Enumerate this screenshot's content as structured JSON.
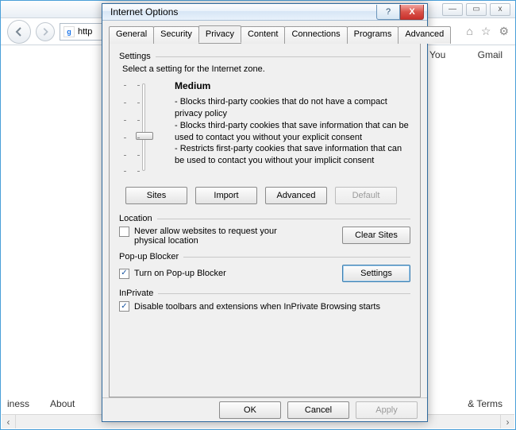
{
  "browser": {
    "addr_scheme": "http",
    "top_links": [
      "You",
      "Gmail"
    ],
    "bottom_links_left": [
      "iness",
      "About"
    ],
    "bottom_links_right": "& Terms",
    "titlebar_icons": {
      "min": "—",
      "max": "▭",
      "close": "x"
    },
    "toolbar_icons": {
      "home": "⌂",
      "star": "☆",
      "gear": "⚙"
    }
  },
  "dialog": {
    "title": "Internet Options",
    "help_icon": "?",
    "close_icon": "X",
    "tabs": [
      "General",
      "Security",
      "Privacy",
      "Content",
      "Connections",
      "Programs",
      "Advanced"
    ],
    "active_tab": 2,
    "settings": {
      "group_label": "Settings",
      "intro": "Select a setting for the Internet zone.",
      "level": "Medium",
      "bullets": [
        "- Blocks third-party cookies that do not have a compact privacy policy",
        "- Blocks third-party cookies that save information that can be used to contact you without your explicit consent",
        "- Restricts first-party cookies that save information that can be used to contact you without your implicit consent"
      ],
      "buttons": {
        "sites": "Sites",
        "import": "Import",
        "advanced": "Advanced",
        "default": "Default"
      }
    },
    "location": {
      "group_label": "Location",
      "never_allow_label": "Never allow websites to request your physical location",
      "never_allow_checked": false,
      "clear_sites": "Clear Sites"
    },
    "popup": {
      "group_label": "Pop-up Blocker",
      "turn_on_label": "Turn on Pop-up Blocker",
      "turn_on_checked": true,
      "settings_btn": "Settings"
    },
    "inprivate": {
      "group_label": "InPrivate",
      "disable_label": "Disable toolbars and extensions when InPrivate Browsing starts",
      "disable_checked": true
    },
    "footer": {
      "ok": "OK",
      "cancel": "Cancel",
      "apply": "Apply"
    }
  }
}
